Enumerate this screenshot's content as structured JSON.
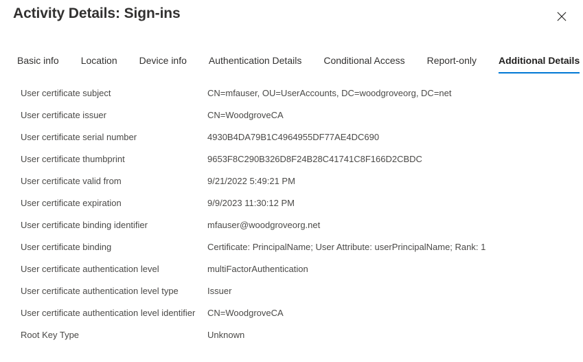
{
  "header": {
    "title": "Activity Details: Sign-ins",
    "close_icon": "close-icon",
    "close_label": "Close"
  },
  "tabs": [
    {
      "label": "Basic info",
      "active": false
    },
    {
      "label": "Location",
      "active": false
    },
    {
      "label": "Device info",
      "active": false
    },
    {
      "label": "Authentication Details",
      "active": false
    },
    {
      "label": "Conditional Access",
      "active": false
    },
    {
      "label": "Report-only",
      "active": false
    },
    {
      "label": "Additional Details",
      "active": true
    }
  ],
  "colors": {
    "accent": "#0078d4",
    "title_text": "#323130",
    "body_text": "#4a4947",
    "background": "#ffffff"
  },
  "details": [
    {
      "label": "User certificate subject",
      "value": "CN=mfauser, OU=UserAccounts, DC=woodgroveorg, DC=net"
    },
    {
      "label": "User certificate issuer",
      "value": "CN=WoodgroveCA"
    },
    {
      "label": "User certificate serial number",
      "value": "4930B4DA79B1C4964955DF77AE4DC690"
    },
    {
      "label": "User certificate thumbprint",
      "value": "9653F8C290B326D8F24B28C41741C8F166D2CBDC"
    },
    {
      "label": "User certificate valid from",
      "value": "9/21/2022 5:49:21 PM"
    },
    {
      "label": "User certificate expiration",
      "value": "9/9/2023 11:30:12 PM"
    },
    {
      "label": "User certificate binding identifier",
      "value": "mfauser@woodgroveorg.net"
    },
    {
      "label": "User certificate binding",
      "value": "Certificate: PrincipalName; User Attribute: userPrincipalName; Rank: 1"
    },
    {
      "label": "User certificate authentication level",
      "value": "multiFactorAuthentication"
    },
    {
      "label": "User certificate authentication level type",
      "value": "Issuer"
    },
    {
      "label": "User certificate authentication level identifier",
      "value": "CN=WoodgroveCA"
    },
    {
      "label": "Root Key Type",
      "value": "Unknown"
    }
  ]
}
